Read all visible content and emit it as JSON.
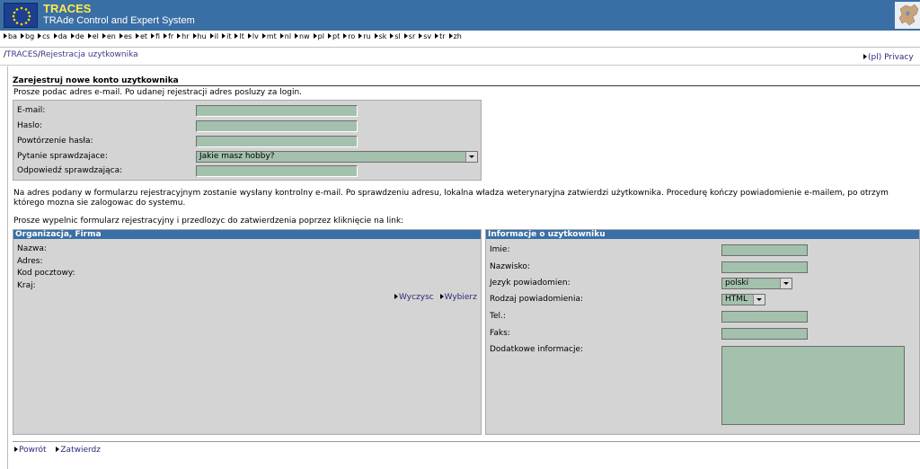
{
  "header": {
    "app_name": "TRACES",
    "app_subtitle": "TRAde Control and Expert System",
    "logo_icon": "eu-stars-icon",
    "map_icon": "europe-map-icon",
    "brand_color": "#3a6fa5"
  },
  "languages": [
    "ba",
    "bg",
    "cs",
    "da",
    "de",
    "el",
    "en",
    "es",
    "et",
    "fi",
    "fr",
    "hr",
    "hu",
    "il",
    "it",
    "lt",
    "lv",
    "mt",
    "nl",
    "nw",
    "pl",
    "pt",
    "ro",
    "ru",
    "sk",
    "sl",
    "sr",
    "sv",
    "tr",
    "zh"
  ],
  "breadcrumb": {
    "root": "TRACES",
    "current": "Rejestracja uzytkownika"
  },
  "privacy_link": "(pl) Privacy",
  "form": {
    "title": "Zarejestruj nowe konto uzytkownika",
    "intro": "Prosze podac adres e-mail. Po udanej rejestracji adres posluzy za login.",
    "email_label": "E-mail:",
    "password_label": "Haslo:",
    "password_repeat_label": "Powtórzenie hasła:",
    "question_label": "Pytanie sprawdzajace:",
    "question_value": "Jakie masz hobby?",
    "answer_label": "Odpowiedź sprawdzająca:"
  },
  "notes": {
    "line1": "Na adres podany w formularzu rejestracyjnym zostanie wysłany kontrolny e-mail. Po sprawdzeniu adresu, lokalna władza weterynaryjna zatwierdzi użytkownika. Procedurę kończy powiadomienie e-mailem, po otrzym",
    "line2": "którego mozna sie zalogowac do systemu.",
    "line3": "Prosze wypelnic formularz rejestracyjny i przedlozyc do zatwierdzenia poprzez kliknięcie na link:"
  },
  "org_panel": {
    "title": "Organizacja, Firma",
    "name_label": "Nazwa:",
    "address_label": "Adres:",
    "postcode_label": "Kod pocztowy:",
    "country_label": "Kraj:",
    "clear_link": "Wyczysc",
    "choose_link": "Wybierz"
  },
  "user_panel": {
    "title": "Informacje o uzytkowniku",
    "firstname_label": "Imie:",
    "lastname_label": "Nazwisko:",
    "lang_label": "Jezyk powiadomien:",
    "lang_value": "polski",
    "notify_type_label": "Rodzaj powiadomienia:",
    "notify_type_value": "HTML",
    "tel_label": "Tel.:",
    "fax_label": "Faks:",
    "extra_label": "Dodatkowe informacje:"
  },
  "footer": {
    "back_link": "Powrót",
    "submit_link": "Zatwierdz"
  },
  "colors": {
    "input_bg": "#a3c1ad",
    "panel_bg": "#d4d4d4",
    "panel_head": "#3a6fa5"
  }
}
